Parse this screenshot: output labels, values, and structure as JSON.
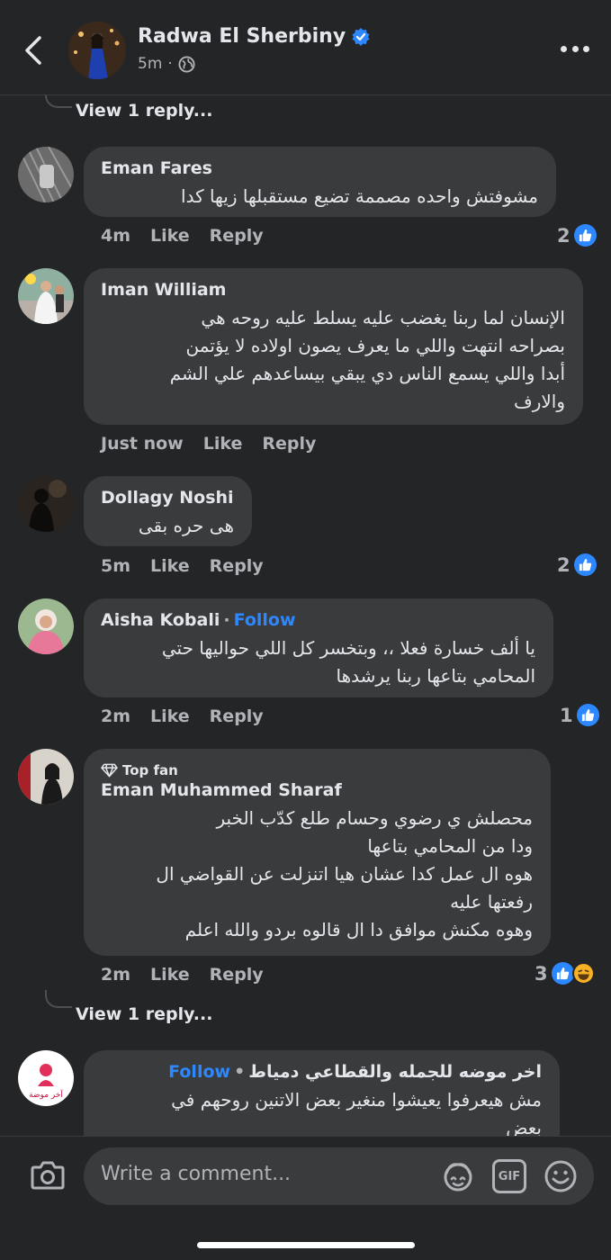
{
  "header": {
    "name": "Radwa El Sherbiny",
    "time": "5m",
    "separator": "·"
  },
  "thread": {
    "view_reply_top": "View 1 reply...",
    "view_reply_bottom": "View 1 reply..."
  },
  "comments": [
    {
      "name": "Eman Fares",
      "text": "مشوفتش واحده مصممة تضيع مستقبلها زيها كدا",
      "time": "4m",
      "like": "Like",
      "reply": "Reply",
      "reactions": "2"
    },
    {
      "name": "Iman William",
      "text": "الإنسان لما ربنا يغضب عليه يسلط عليه روحه هي\nبصراحه انتهت واللي ما يعرف يصون اولاده لا يؤتمن\nأبدا واللي يسمع الناس دي يبقي بيساعدهم علي الشم\nوالارف",
      "time": "Just now",
      "like": "Like",
      "reply": "Reply"
    },
    {
      "name": "Dollagy Noshi",
      "text": "هى حره بقى",
      "time": "5m",
      "like": "Like",
      "reply": "Reply",
      "reactions": "2"
    },
    {
      "name": "Aisha Kobali",
      "dot": "·",
      "follow": "Follow",
      "text": "يا ألف خسارة فعلا ،،  وبتخسر كل اللي حواليها حتي\nالمحامي بتاعها ربنا يرشدها",
      "time": "2m",
      "like": "Like",
      "reply": "Reply",
      "reactions": "1"
    },
    {
      "badge": "Top fan",
      "name": "Eman Muhammed Sharaf",
      "text": "محصلش ي رضوي وحسام طلع كدّب الخبر\nودا من المحامي بتاعها\nهوه ال عمل كدا عشان هيا  اتنزلت عن القواضي ال\nرفعتها عليه\nوهوه مكنش موافق دا ال قالوه بردو والله اعلم",
      "time": "2m",
      "like": "Like",
      "reply": "Reply",
      "reactions": "3"
    },
    {
      "name": "اخر موضه للجمله والقطاعي دمياط",
      "dot": "•",
      "follow": "Follow",
      "avatar_text": "آخر موضة",
      "text": "مش هيعرفوا يعيشوا منغير بعض الاتنين روحهم في\nبعض"
    }
  ],
  "composer": {
    "placeholder": "Write a comment...",
    "gif_label": "GIF"
  },
  "colors": {
    "background": "#242526",
    "bubble": "#3a3b3c",
    "accent": "#2d88ff",
    "secondary_text": "#b0b3b8"
  },
  "icons": [
    "back-chevron-icon",
    "verified-badge-icon",
    "globe-icon",
    "more-icon",
    "like-reaction-icon",
    "haha-reaction-icon",
    "diamond-icon",
    "camera-icon",
    "avatar-sticker-icon",
    "gif-icon",
    "emoji-icon"
  ]
}
